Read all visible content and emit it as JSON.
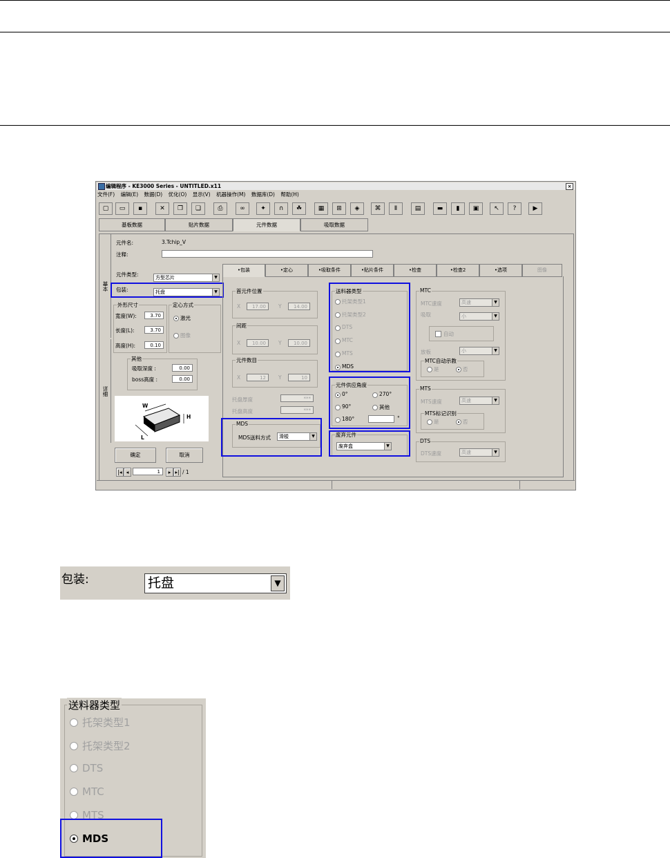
{
  "window": {
    "title": "编辑程序 - KE3000 Series - UNTITLED.x11",
    "close_glyph": "×"
  },
  "menu": [
    "文件(F)",
    "编辑(E)",
    "数据(D)",
    "优化(O)",
    "显示(V)",
    "机器操作(M)",
    "数据库(D)",
    "帮助(H)"
  ],
  "main_tabs": [
    "基板数据",
    "贴片数据",
    "元件数据",
    "吸取数据"
  ],
  "active_main_tab": "元件数据",
  "component": {
    "name_label": "元件名:",
    "name_value": "3.Tchip_V",
    "comment_label": "注释:",
    "type_label": "元件类型:",
    "type_value": "方型芯片",
    "package_label": "包装:",
    "package_value": "托盘"
  },
  "side_labels": [
    "基本",
    "详细"
  ],
  "dimensions": {
    "title": "外形尺寸",
    "width_label": "宽度(W):",
    "width_value": "3.70",
    "length_label": "长度(L):",
    "length_value": "3.70",
    "height_label": "高度(H):",
    "height_value": "0.10"
  },
  "centering": {
    "title": "定心方式",
    "laser": "激光",
    "image": "图像"
  },
  "other": {
    "title": "其他",
    "pick_depth_label": "吸取深度 :",
    "pick_depth_value": "0.00",
    "boss_height_label": "boss高度 :",
    "boss_height_value": "0.00"
  },
  "diagram_labels": {
    "w": "W",
    "h": "H",
    "l": "L"
  },
  "buttons": {
    "ok": "确定",
    "cancel": "取消"
  },
  "pager": {
    "value": "1",
    "total": "/ 1"
  },
  "sub_tabs": [
    "•包装",
    "•定心",
    "•吸取条件",
    "•贴片条件",
    "•检查",
    "•检查2",
    "•选项",
    "图像"
  ],
  "first_pos": {
    "title": "首元件位置",
    "x_label": "X",
    "x_value": "17.00",
    "y_label": "Y",
    "y_value": "14.00"
  },
  "pitch": {
    "title": "间距",
    "x_label": "X",
    "x_value": "10.00",
    "y_label": "Y",
    "y_value": "10.00"
  },
  "count": {
    "title": "元件数目",
    "x_label": "X",
    "x_value": "12",
    "y_label": "Y",
    "y_value": "10"
  },
  "tray_thickness_label": "托盘厚度",
  "tray_thickness_value": "***",
  "tray_height_label": "托盘高度",
  "tray_height_value": "***",
  "mds": {
    "title": "MDS",
    "mode_label": "MDS送料方式",
    "mode_value": "滑梭"
  },
  "feeder_type": {
    "title": "送料器类型",
    "options": [
      "托架类型1",
      "托架类型2",
      "DTS",
      "MTC",
      "MTS",
      "MDS"
    ],
    "selected": "MDS"
  },
  "supply_angle": {
    "title": "元件供应角度",
    "a0": "0°",
    "a270": "270°",
    "a90": "90°",
    "other": "其他",
    "a180": "180°",
    "unit": "°"
  },
  "discard": {
    "title": "废弃元件",
    "value": "废弃盒"
  },
  "mtc": {
    "title": "MTC",
    "speed_label": "MTC速度",
    "speed_value": "高速",
    "pick_label": "吸取",
    "pick_value": "小",
    "auto_label": "自动",
    "lower_label": "放板",
    "lower_value": "小",
    "auto_show_title": "MTC自动示教",
    "yes": "是",
    "no": "否"
  },
  "mts": {
    "title": "MTS",
    "speed_label": "MTS速度",
    "speed_value": "高速",
    "mark_title": "MTS标记识别",
    "yes": "是",
    "no": "否"
  },
  "dts": {
    "title": "DTS",
    "speed_label": "DTS速度",
    "speed_value": "高速"
  },
  "zoom_package": {
    "label": "包装:",
    "value": "托盘",
    "arrow": "▼"
  },
  "zoom_feeder": {
    "title": "送料器类型",
    "options": [
      "托架类型1",
      "托架类型2",
      "DTS",
      "MTC",
      "MTS",
      "MDS"
    ],
    "selected": "MDS"
  },
  "colors": {
    "highlight": "#1010e0",
    "dialog_bg": "#d4d0c8"
  }
}
